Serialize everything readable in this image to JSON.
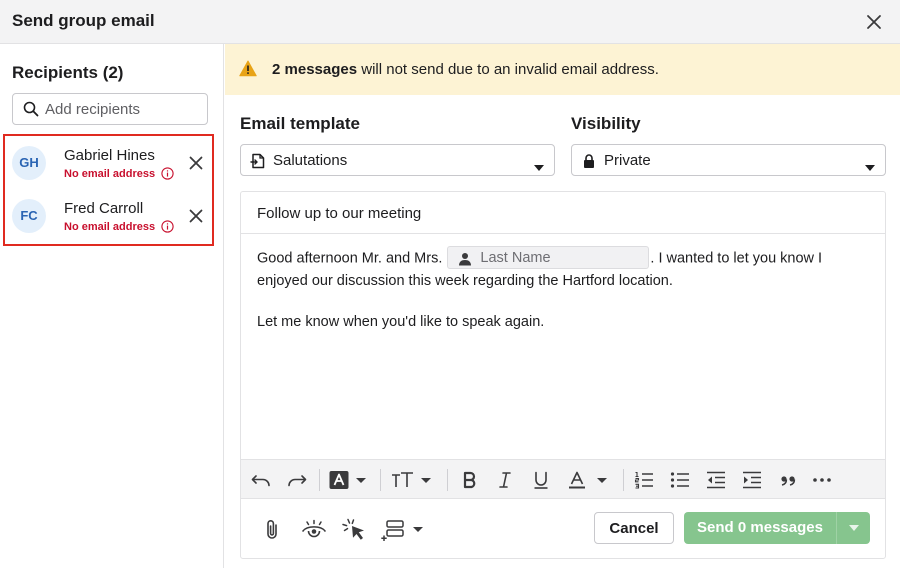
{
  "dialog": {
    "title": "Send group email"
  },
  "recipients": {
    "heading": "Recipients (2)",
    "search_placeholder": "Add recipients",
    "items": [
      {
        "initials": "GH",
        "name": "Gabriel Hines",
        "error": "No email address"
      },
      {
        "initials": "FC",
        "name": "Fred Carroll",
        "error": "No email address"
      }
    ]
  },
  "warning": {
    "bold": "2 messages",
    "text": " will not send due to an invalid email address."
  },
  "template": {
    "label": "Email template",
    "value": "Salutations"
  },
  "visibility": {
    "label": "Visibility",
    "value": "Private"
  },
  "email": {
    "subject": "Follow up to our meeting",
    "body_part1": "Good afternoon Mr. and Mrs.",
    "merge_field": "Last Name",
    "body_part2": ". I wanted to let you know I enjoyed our discussion this week regarding the  Hartford location.",
    "body_para2": "Let me know when you'd like to speak again."
  },
  "actions": {
    "cancel": "Cancel",
    "send": "Send 0 messages"
  },
  "colors": {
    "accent_blue": "#2a64b3",
    "error_red": "#c8102e",
    "warning_bg": "#fdf3d4",
    "send_green": "#86c58e",
    "highlight_red": "#e02a20"
  }
}
